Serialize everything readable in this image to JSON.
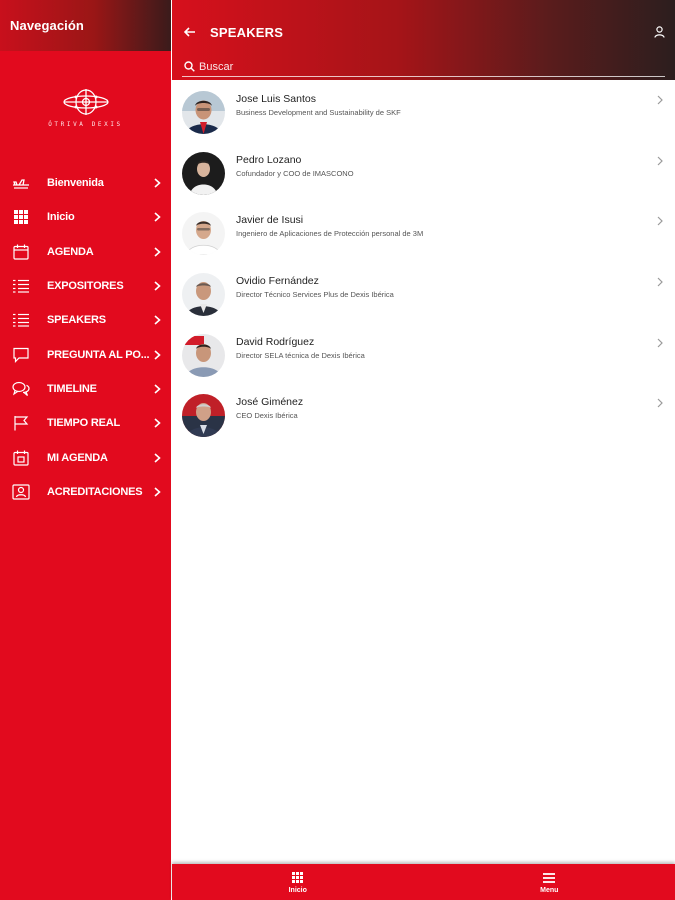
{
  "sidebar": {
    "title": "Navegación",
    "logo_text": "ÓTRIVA DEXIS",
    "items": [
      {
        "label": "Bienvenida",
        "icon": "plane-icon"
      },
      {
        "label": "Inicio",
        "icon": "grid-icon"
      },
      {
        "label": "AGENDA",
        "icon": "calendar-icon"
      },
      {
        "label": "EXPOSITORES",
        "icon": "list-icon"
      },
      {
        "label": "SPEAKERS",
        "icon": "list-icon"
      },
      {
        "label": "PREGUNTA AL PO...",
        "icon": "chat-bubble-icon"
      },
      {
        "label": "TIMELINE",
        "icon": "chat-bubbles-icon"
      },
      {
        "label": "TIEMPO REAL",
        "icon": "flag-icon"
      },
      {
        "label": "MI AGENDA",
        "icon": "calendar-check-icon"
      },
      {
        "label": "ACREDITACIONES",
        "icon": "id-badge-icon"
      }
    ]
  },
  "header": {
    "title": "SPEAKERS",
    "search_placeholder": "Buscar"
  },
  "speakers": [
    {
      "name": "Jose Luis Santos",
      "role": "Business Development and Sustainability de SKF"
    },
    {
      "name": "Pedro Lozano",
      "role": "Cofundador y COO de IMASCONO"
    },
    {
      "name": "Javier de Isusi",
      "role": "Ingeniero de Aplicaciones de Protección personal de 3M"
    },
    {
      "name": "Ovidio Fernández",
      "role": "Director Técnico Services Plus de Dexis Ibérica"
    },
    {
      "name": "David Rodríguez",
      "role": "Director SELA técnica de Dexis Ibérica"
    },
    {
      "name": "José Giménez",
      "role": "CEO Dexis Ibérica"
    }
  ],
  "bottom_tabs": [
    {
      "label": "Inicio",
      "icon": "grid-icon"
    },
    {
      "label": "Menu",
      "icon": "hamburger-icon"
    }
  ],
  "colors": {
    "brand_red": "#e20a1e",
    "header_dark": "#2c1e1e",
    "text_dark": "#222222"
  }
}
